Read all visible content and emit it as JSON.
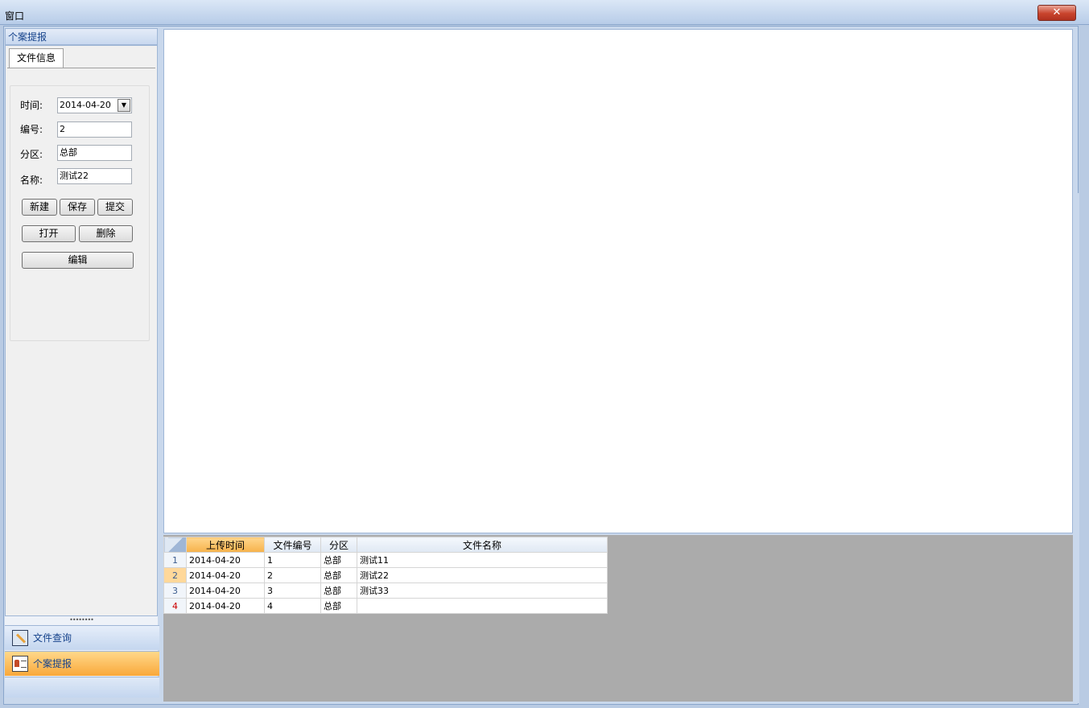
{
  "window": {
    "title": "窗口",
    "close_label": "✕"
  },
  "left_panel": {
    "header": "个案提报",
    "tab_label": "文件信息",
    "form": {
      "time_label": "时间:",
      "time_value": "2014-04-20",
      "number_label": "编号:",
      "number_value": "2",
      "district_label": "分区:",
      "district_value": "总部",
      "name_label": "名称:",
      "name_value": "测试22"
    },
    "buttons": {
      "new": "新建",
      "save": "保存",
      "submit": "提交",
      "open": "打开",
      "delete": "删除",
      "edit": "编辑"
    },
    "nav": {
      "file_query": "文件查询",
      "case_report": "个案提报"
    }
  },
  "grid": {
    "columns": [
      "上传时间",
      "文件编号",
      "分区",
      "文件名称"
    ],
    "rows": [
      {
        "num": "1",
        "time": "2014-04-20",
        "id": "1",
        "district": "总部",
        "name": "测试11"
      },
      {
        "num": "2",
        "time": "2014-04-20",
        "id": "2",
        "district": "总部",
        "name": "测试22"
      },
      {
        "num": "3",
        "time": "2014-04-20",
        "id": "3",
        "district": "总部",
        "name": "测试33"
      },
      {
        "num": "4",
        "time": "2014-04-20",
        "id": "4",
        "district": "总部",
        "name": ""
      }
    ]
  }
}
